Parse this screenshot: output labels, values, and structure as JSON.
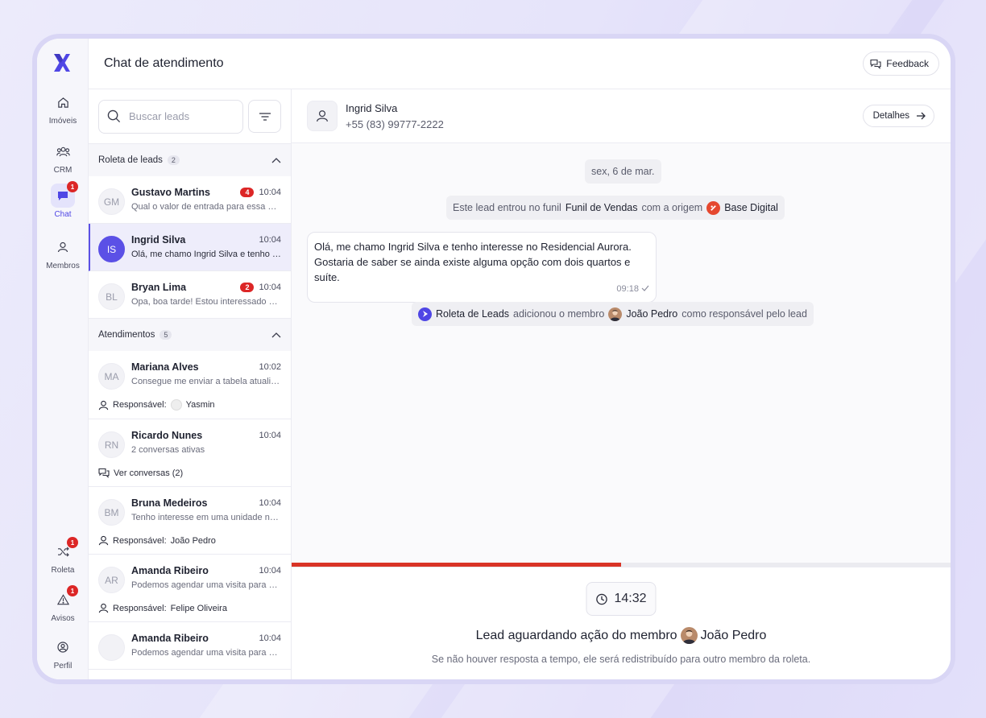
{
  "app": {
    "title": "Chat de atendimento",
    "feedback_label": "Feedback"
  },
  "nav": {
    "items": [
      {
        "label": "Imóveis",
        "icon": "home-icon"
      },
      {
        "label": "CRM",
        "icon": "users-icon"
      },
      {
        "label": "Chat",
        "icon": "chat-icon",
        "badge": "1",
        "active": true
      },
      {
        "label": "Membros",
        "icon": "user-icon"
      }
    ],
    "bottom": [
      {
        "label": "Roleta",
        "icon": "shuffle-icon",
        "badge": "1"
      },
      {
        "label": "Avisos",
        "icon": "alert-icon",
        "badge": "1"
      },
      {
        "label": "Perfil",
        "icon": "profile-icon"
      }
    ]
  },
  "search": {
    "placeholder": "Buscar leads"
  },
  "roleta_section": {
    "title": "Roleta de leads",
    "count": "2"
  },
  "roleta_leads": [
    {
      "initials": "GM",
      "name": "Gustavo Martins",
      "unread": "4",
      "time": "10:04",
      "preview": "Qual o valor de entrada para essa unidade?"
    },
    {
      "initials": "IS",
      "name": "Ingrid Silva",
      "time": "10:04",
      "preview": "Olá, me chamo Ingrid Silva e tenho interesse"
    },
    {
      "initials": "BL",
      "name": "Bryan Lima",
      "unread": "2",
      "time": "10:04",
      "preview": "Opa, boa tarde! Estou interessado no imóvel"
    }
  ],
  "atendimentos_section": {
    "title": "Atendimentos",
    "count": "5"
  },
  "atendimentos": [
    {
      "initials": "MA",
      "name": "Mariana Alves",
      "time": "10:02",
      "preview": "Consegue me enviar a tabela atualizada?",
      "extra_label": "Responsável:",
      "extra_value": "Yasmin"
    },
    {
      "initials": "RN",
      "name": "Ricardo Nunes",
      "time": "10:04",
      "preview": "2 conversas ativas",
      "extra_label": "Ver conversas (2)"
    },
    {
      "initials": "BM",
      "name": "Bruna Medeiros",
      "time": "10:04",
      "preview": "Tenho interesse em uma unidade no térreo",
      "extra_label": "Responsável:",
      "extra_value": "João Pedro"
    },
    {
      "initials": "AR",
      "name": "Amanda Ribeiro",
      "time": "10:04",
      "preview": "Podemos agendar uma visita para sábado?",
      "extra_label": "Responsável:",
      "extra_value": "Felipe Oliveira"
    },
    {
      "initials": "",
      "name": "Amanda Ribeiro",
      "time": "10:04",
      "preview": "Podemos agendar uma visita para sábado?"
    }
  ],
  "chat": {
    "contact_name": "Ingrid Silva",
    "contact_phone": "+55 (83) 99777-2222",
    "details_label": "Detalhes",
    "date_chip": "sex, 6 de mar.",
    "funnel": {
      "pre": "Este lead entrou no funil",
      "funnel": "Funil de Vendas",
      "mid": "com a origem",
      "origin": "Base Digital"
    },
    "message": {
      "part1": "Olá, me chamo Ingrid Silva e tenho interesse no ",
      "bold": "Residencial Aurora",
      "part2": ". Gostaria de saber se ainda existe alguma opção com dois quartos e suíte.",
      "time": "09:18"
    },
    "assign": {
      "actor": "Roleta de Leads",
      "mid": "adicionou o membro",
      "member": "João Pedro",
      "post": "como responsável pelo lead"
    },
    "progress_percent": 50
  },
  "waiting": {
    "timer": "14:32",
    "title": "Lead aguardando ação do membro",
    "member": "João Pedro",
    "subtitle": "Se não houver resposta a tempo, ele será redistribuído para outro membro da roleta."
  },
  "colors": {
    "accent": "#4f46e5",
    "badge": "#dc2626",
    "progress": "#d93426"
  }
}
